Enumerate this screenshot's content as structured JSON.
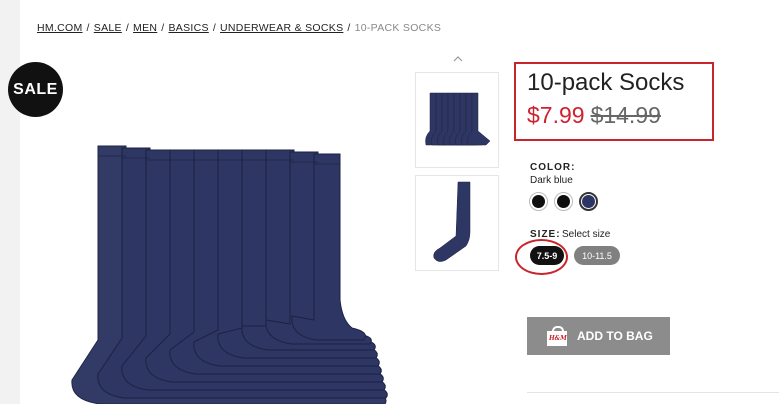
{
  "breadcrumb": {
    "items": [
      "HM.COM",
      "SALE",
      "MEN",
      "BASICS",
      "UNDERWEAR & SOCKS"
    ],
    "separator": "/",
    "current": "10-PACK SOCKS"
  },
  "badge": {
    "label": "SALE"
  },
  "product": {
    "title": "10-pack Socks",
    "sale_price": "$7.99",
    "original_price": "$14.99"
  },
  "color": {
    "label": "COLOR:",
    "selected": "Dark blue",
    "swatches": [
      {
        "name": "black",
        "hex": "#0f0f0f"
      },
      {
        "name": "black",
        "hex": "#0f0f0f"
      },
      {
        "name": "dark blue",
        "hex": "#2c3563"
      }
    ]
  },
  "size": {
    "label": "SIZE:",
    "hint": "Select size",
    "options": [
      "7.5-9",
      "10-11.5"
    ]
  },
  "cart": {
    "add_label": "ADD TO BAG",
    "icon": "shopping-bag-icon",
    "icon_text": "H&M"
  },
  "colors": {
    "sale_red": "#d0212e",
    "highlight_red": "#c8242b",
    "sock_navy": "#2e3763"
  }
}
